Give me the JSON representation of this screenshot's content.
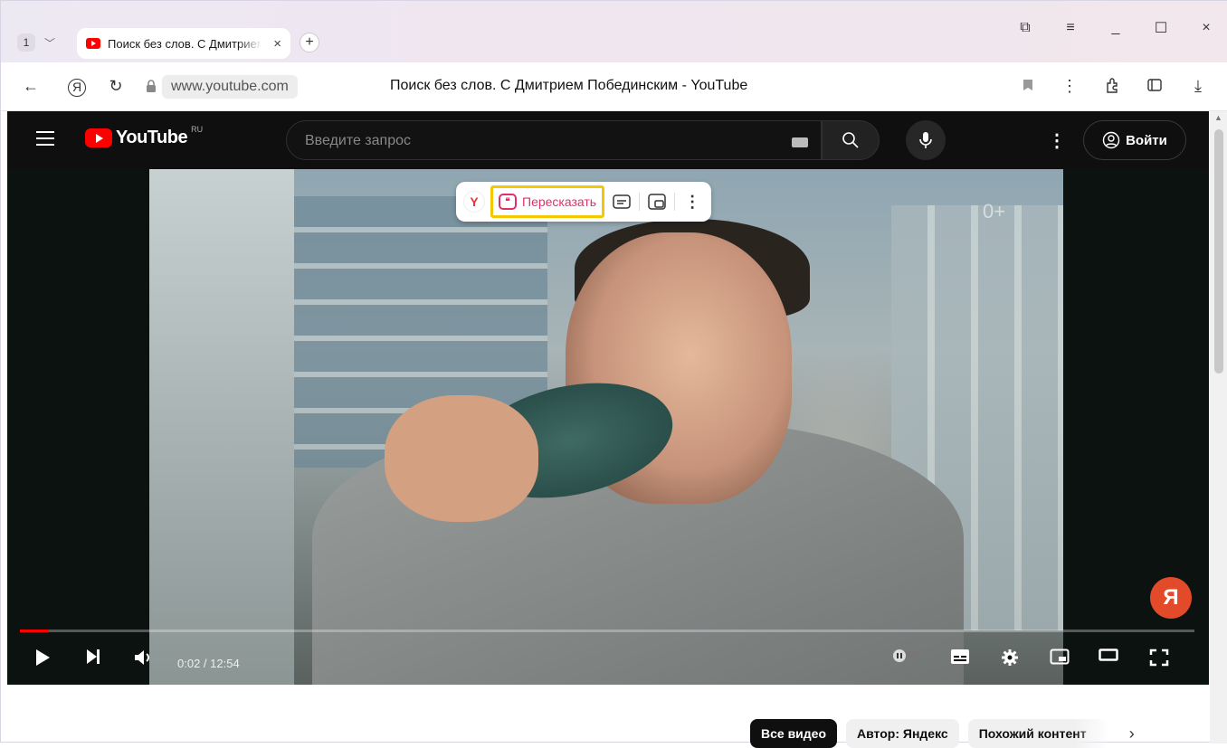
{
  "browser": {
    "tab_count": "1",
    "tab": {
      "title": "Поиск без слов. С Дмитрием Побединским - YouTube",
      "close_glyph": "×"
    },
    "new_tab_glyph": "+",
    "window_controls": {
      "bookmarks_glyph": "⧉",
      "menu_glyph": "≡",
      "minimize_glyph": "_",
      "maximize_glyph": "☐",
      "close_glyph": "×"
    },
    "toolbar": {
      "back_glyph": "←",
      "yandex_glyph": "Я",
      "reload_glyph": "↻",
      "domain": "www.youtube.com",
      "page_title": "Поиск без слов. С Дмитрием Побединским - YouTube",
      "download_glyph": "⤓"
    }
  },
  "youtube": {
    "logo_word": "YouTube",
    "region": "RU",
    "search_placeholder": "Введите запрос",
    "sign_in": "Войти",
    "more_glyph": "⋮"
  },
  "video": {
    "age_rating": "0+",
    "retell_label": "Пересказать",
    "retell_quote": "❝",
    "ya_bar_logo": "Y",
    "more_glyph": "⋮",
    "yandex_badge": "Я",
    "time_display": "0:02 / 12:54",
    "progress_fraction": 0.025
  },
  "chips": {
    "items": [
      "Все видео",
      "Автор: Яндекс",
      "Похожий контент"
    ],
    "next_glyph": "›"
  },
  "icons": {
    "youtube_red": "#ff0000",
    "retell_pink": "#e0306a",
    "highlight_yellow": "#f2c800",
    "yandex_red": "#e24a2a"
  }
}
